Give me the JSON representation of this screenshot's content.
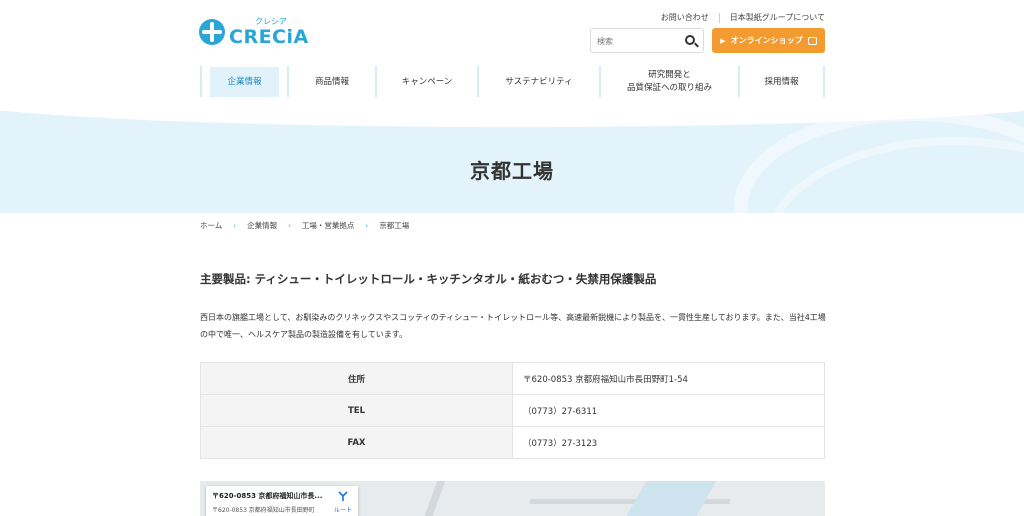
{
  "header": {
    "logo": {
      "kana": "クレシア",
      "name": "CRECiA"
    },
    "util_links": [
      "お問い合わせ",
      "日本製紙グループについて"
    ],
    "search": {
      "placeholder": "検索"
    },
    "shop_button": "オンラインショップ",
    "nav": [
      {
        "label": "企業情報",
        "active": true
      },
      {
        "label": "商品情報"
      },
      {
        "label": "キャンペーン"
      },
      {
        "label": "サステナビリティ"
      },
      {
        "label": "研究開発と\n品質保証への取り組み"
      },
      {
        "label": "採用情報"
      }
    ]
  },
  "hero": {
    "title": "京都工場"
  },
  "breadcrumb": [
    "ホーム",
    "企業情報",
    "工場・営業拠点",
    "京都工場"
  ],
  "content": {
    "heading": "主要製品: ティシュー・トイレットロール・キッチンタオル・紙おむつ・失禁用保護製品",
    "description": "西日本の旗艦工場として、お馴染みのクリネックスやスコッティのティシュー・トイレットロール等、高速最新鋭機により製品を、一貫性生産しております。また、当社4工場の中で唯一、ヘルスケア製品の製造設備を有しています。",
    "table": [
      {
        "key": "住所",
        "value": "〒620-0853 京都府福知山市長田野町1-54"
      },
      {
        "key": "TEL",
        "value": "（0773）27-6311"
      },
      {
        "key": "FAX",
        "value": "（0773）27-3123"
      }
    ]
  },
  "map": {
    "title": "〒620-0853 京都府福知山市長...",
    "subtitle": "〒620-0853 京都府福知山市長田野町",
    "route_label": "ルート"
  },
  "colors": {
    "brand": "#2aa5d6",
    "shop": "#f39b2f",
    "hero_bg": "#e3f3fb"
  }
}
